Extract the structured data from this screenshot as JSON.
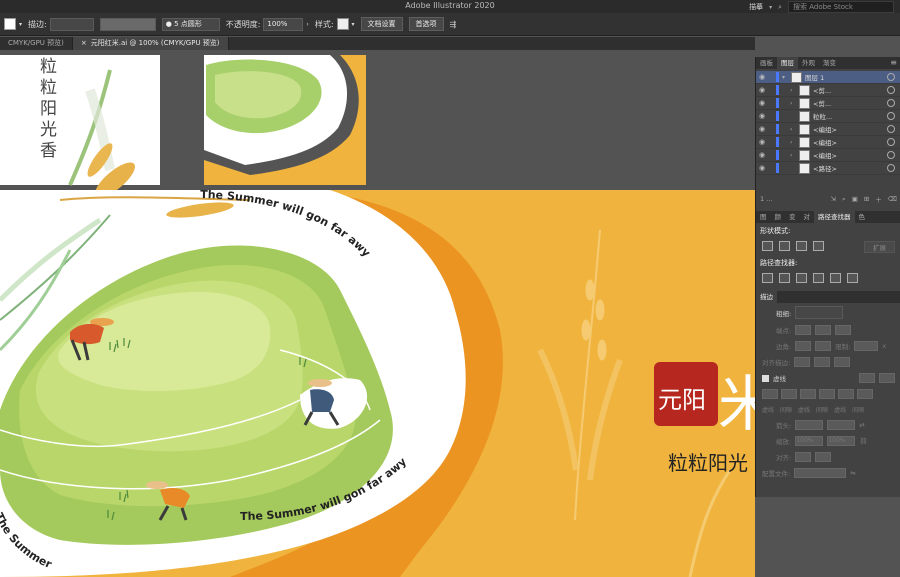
{
  "app": {
    "title": "Adobe Illustrator 2020",
    "workspace": "描摹",
    "search_placeholder": "搜索 Adobe Stock"
  },
  "control_bar": {
    "stroke_label": "描边:",
    "brush_label": "5 点圆形",
    "opacity_label": "不透明度:",
    "opacity_value": "100%",
    "style_label": "样式:",
    "doc_setup": "文档设置",
    "preferences": "首选项"
  },
  "tabs": [
    {
      "label": "CMYK/GPU 预览)",
      "active": false
    },
    {
      "label": "元阳红米.ai @ 100% (CMYK/GPU 预览)",
      "active": true
    }
  ],
  "artwork": {
    "vertical_text": [
      "粒",
      "粒",
      "阳",
      "光",
      "香"
    ],
    "curved_text": "The Summer will gon far awy",
    "curved_text_bottom": "The Summer will gon far awy",
    "curved_text_partial": "The Summer",
    "curved_text_top": "The Summer will gon far awy",
    "seal_text": "元阳",
    "subtitle": "粒粒阳光",
    "deco_char": "米"
  },
  "layers_panel": {
    "tabs": [
      "画板",
      "图层",
      "外观",
      "渐变"
    ],
    "active_tab": "图层",
    "rows": [
      {
        "label": "图层 1",
        "level": 0,
        "selected": true
      },
      {
        "label": "<剪...",
        "level": 1
      },
      {
        "label": "<剪...",
        "level": 1
      },
      {
        "label": "粒粒...",
        "level": 1
      },
      {
        "label": "<编组>",
        "level": 1
      },
      {
        "label": "<编组>",
        "level": 1
      },
      {
        "label": "<编组>",
        "level": 1
      },
      {
        "label": "<路径>",
        "level": 1
      }
    ],
    "footer_count": "1 ..."
  },
  "pathfinder": {
    "tabs": [
      "图",
      "颜",
      "变",
      "对",
      "路径查找器",
      "色"
    ],
    "active_tab": "路径查找器",
    "shape_modes": "形状模式:",
    "expand": "扩展",
    "pathfinders": "路径查找器:"
  },
  "stroke_panel": {
    "title": "描边",
    "weight_label": "粗细:",
    "cap_label": "端点:",
    "corner_label": "边角:",
    "limit_label": "限制:",
    "limit_value": "x",
    "align_label": "对齐描边:",
    "dashed_label": "虚线",
    "dash_cols": [
      "虚线",
      "间隙",
      "虚线",
      "间隙",
      "虚线",
      "间隙"
    ],
    "arrow_label": "箭头:",
    "scale_label": "缩放:",
    "scale_values": [
      "100%",
      "100%"
    ],
    "align2_label": "对齐:",
    "profile_label": "配置文件:"
  }
}
